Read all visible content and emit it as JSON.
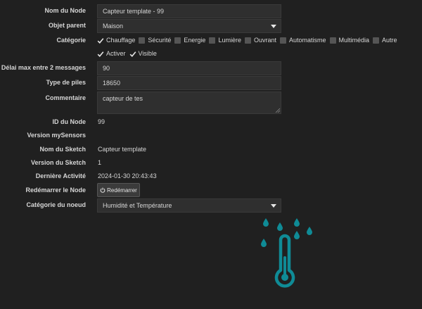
{
  "form": {
    "node_name": {
      "label": "Nom du Node",
      "value": "Capteur template - 99"
    },
    "parent_object": {
      "label": "Objet parent",
      "value": "Maison"
    },
    "category": {
      "label": "Catégorie",
      "options": [
        {
          "label": "Chauffage",
          "checked": true
        },
        {
          "label": "Sécurité",
          "checked": false
        },
        {
          "label": "Energie",
          "checked": false
        },
        {
          "label": "Lumière",
          "checked": false
        },
        {
          "label": "Ouvrant",
          "checked": false
        },
        {
          "label": "Automatisme",
          "checked": false
        },
        {
          "label": "Multimédia",
          "checked": false
        },
        {
          "label": "Autre",
          "checked": false
        }
      ]
    },
    "flags": [
      {
        "label": "Activer",
        "checked": true
      },
      {
        "label": "Visible",
        "checked": true
      }
    ],
    "max_delay": {
      "label": "Délai max entre 2 messages",
      "value": "90"
    },
    "battery_type": {
      "label": "Type de piles",
      "value": "18650"
    },
    "comment": {
      "label": "Commentaire",
      "value": "capteur de tes"
    },
    "node_id": {
      "label": "ID du Node",
      "value": "99"
    },
    "mysensors_version": {
      "label": "Version mySensors",
      "value": ""
    },
    "sketch_name": {
      "label": "Nom du Sketch",
      "value": "Capteur template"
    },
    "sketch_version": {
      "label": "Version du Sketch",
      "value": "1"
    },
    "last_activity": {
      "label": "Dernière Activité",
      "value": "2024-01-30 20:43:43"
    },
    "restart": {
      "label": "Redémarrer le Node",
      "button_label": "Redémarrer"
    },
    "node_category": {
      "label": "Catégorie du noeud",
      "value": "Humidité et Température"
    }
  },
  "illustration": {
    "icon": "thermometer-rain-icon",
    "color": "#0f8b96"
  },
  "colors": {
    "background": "#202020",
    "field": "#2f2f2f",
    "accent": "#0f8b96"
  }
}
